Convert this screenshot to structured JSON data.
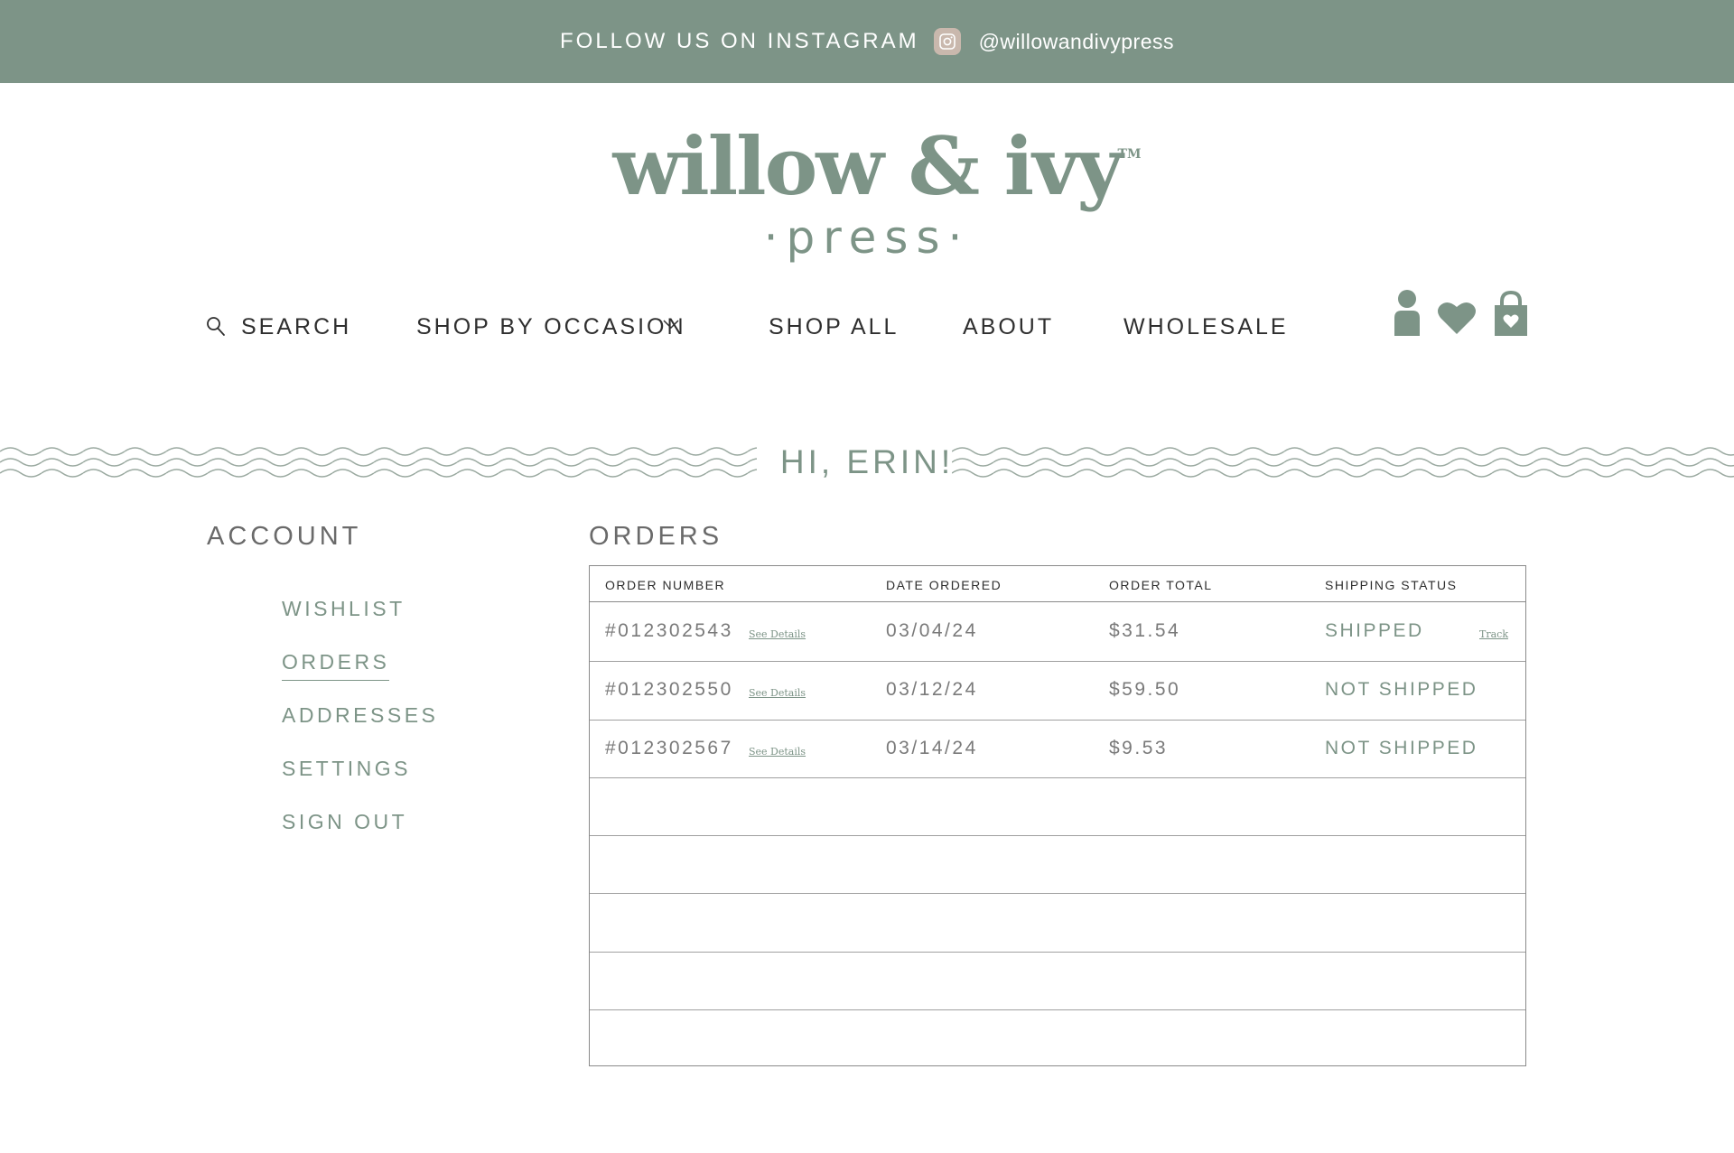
{
  "colors": {
    "brand": "#7d9487",
    "top_bar": "#7d9487",
    "instagram_badge": "#c9b8ad"
  },
  "top_bar": {
    "follow_text": "FOLLOW US ON INSTAGRAM",
    "instagram_icon": "instagram-icon",
    "handle": "@willowandivypress"
  },
  "logo": {
    "main": "willow & ivy",
    "tm": "TM",
    "sub": "·press·"
  },
  "nav": {
    "search_label": "SEARCH",
    "shop_by_occasion_label": "SHOP BY OCCASION",
    "shop_all_label": "SHOP ALL",
    "about_label": "ABOUT",
    "wholesale_label": "WHOLESALE",
    "icons": [
      "search-icon",
      "chevron-down-icon",
      "account-icon",
      "heart-icon",
      "shopping-bag-icon"
    ]
  },
  "greeting": "HI, ERIN!",
  "account": {
    "title": "ACCOUNT",
    "links": [
      "WISHLIST",
      "ORDERS",
      "ADDRESSES",
      "SETTINGS",
      "SIGN OUT"
    ],
    "active": "ORDERS"
  },
  "orders": {
    "title": "ORDERS",
    "columns": [
      "ORDER NUMBER",
      "DATE ORDERED",
      "ORDER TOTAL",
      "SHIPPING STATUS"
    ],
    "rows": [
      {
        "number": "#012302543",
        "details_link": "See Details",
        "date": "03/04/24",
        "total": "$31.54",
        "status": "SHIPPED",
        "track_link": "Track"
      },
      {
        "number": "#012302550",
        "details_link": "See Details",
        "date": "03/12/24",
        "total": "$59.50",
        "status": "NOT SHIPPED"
      },
      {
        "number": "#012302567",
        "details_link": "See Details",
        "date": "03/14/24",
        "total": "$9.53",
        "status": "NOT SHIPPED"
      }
    ]
  }
}
